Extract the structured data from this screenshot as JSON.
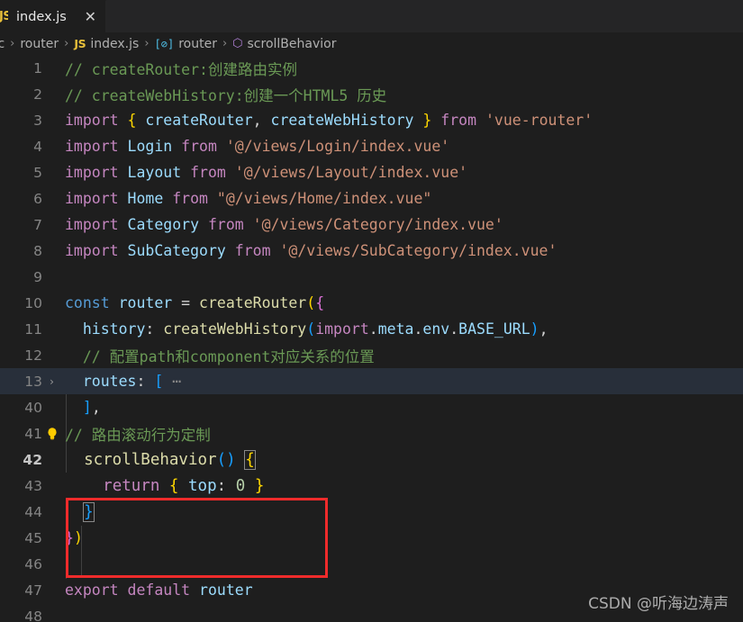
{
  "window": {
    "background": "#1e1e1e"
  },
  "tabbar": {
    "tab": {
      "icon": "javascript-file-icon",
      "icon_text": "JS",
      "label": "index.js",
      "close_label": "✕"
    }
  },
  "breadcrumb": {
    "items": [
      {
        "icon": null,
        "label": "rc"
      },
      {
        "icon": null,
        "label": "router"
      },
      {
        "icon": "javascript-file-icon",
        "icon_text": "JS",
        "label": "index.js"
      },
      {
        "icon": "object-symbol-icon",
        "icon_text": "[⊘]",
        "label": "router"
      },
      {
        "icon": "cube-symbol-icon",
        "icon_text": "⬡",
        "label": "scrollBehavior"
      }
    ],
    "separator": "›"
  },
  "editor": {
    "language": "javascript",
    "current_line": 42,
    "highlighted_line": 13,
    "lightbulb_line": 41,
    "folded_line": 13,
    "lines": [
      {
        "num": "1",
        "text": "// createRouter:创建路由实例"
      },
      {
        "num": "2",
        "text": "// createWebHistory:创建一个HTML5 历史"
      },
      {
        "num": "3",
        "text": "import { createRouter, createWebHistory } from 'vue-router'"
      },
      {
        "num": "4",
        "text": "import Login from '@/views/Login/index.vue'"
      },
      {
        "num": "5",
        "text": "import Layout from '@/views/Layout/index.vue'"
      },
      {
        "num": "6",
        "text": "import Home from \"@/views/Home/index.vue\""
      },
      {
        "num": "7",
        "text": "import Category from '@/views/Category/index.vue'"
      },
      {
        "num": "8",
        "text": "import SubCategory from '@/views/SubCategory/index.vue'"
      },
      {
        "num": "9",
        "text": ""
      },
      {
        "num": "10",
        "text": "const router = createRouter({"
      },
      {
        "num": "11",
        "text": "  history: createWebHistory(import.meta.env.BASE_URL),"
      },
      {
        "num": "12",
        "text": "  // 配置path和component对应关系的位置"
      },
      {
        "num": "13",
        "text": "  routes: [ ⋯"
      },
      {
        "num": "40",
        "text": "  ],"
      },
      {
        "num": "41",
        "text": "// 路由滚动行为定制"
      },
      {
        "num": "42",
        "text": "  scrollBehavior() {"
      },
      {
        "num": "43",
        "text": "    return { top: 0 }"
      },
      {
        "num": "44",
        "text": "  }"
      },
      {
        "num": "45",
        "text": "})"
      },
      {
        "num": "46",
        "text": ""
      },
      {
        "num": "47",
        "text": "export default router"
      },
      {
        "num": "48",
        "text": ""
      }
    ]
  },
  "annotation": {
    "type": "red-rectangle",
    "color": "#ef2b2b",
    "covers_lines": [
      "42",
      "43",
      "44"
    ]
  },
  "watermark": {
    "text": "CSDN @听海边涛声"
  }
}
